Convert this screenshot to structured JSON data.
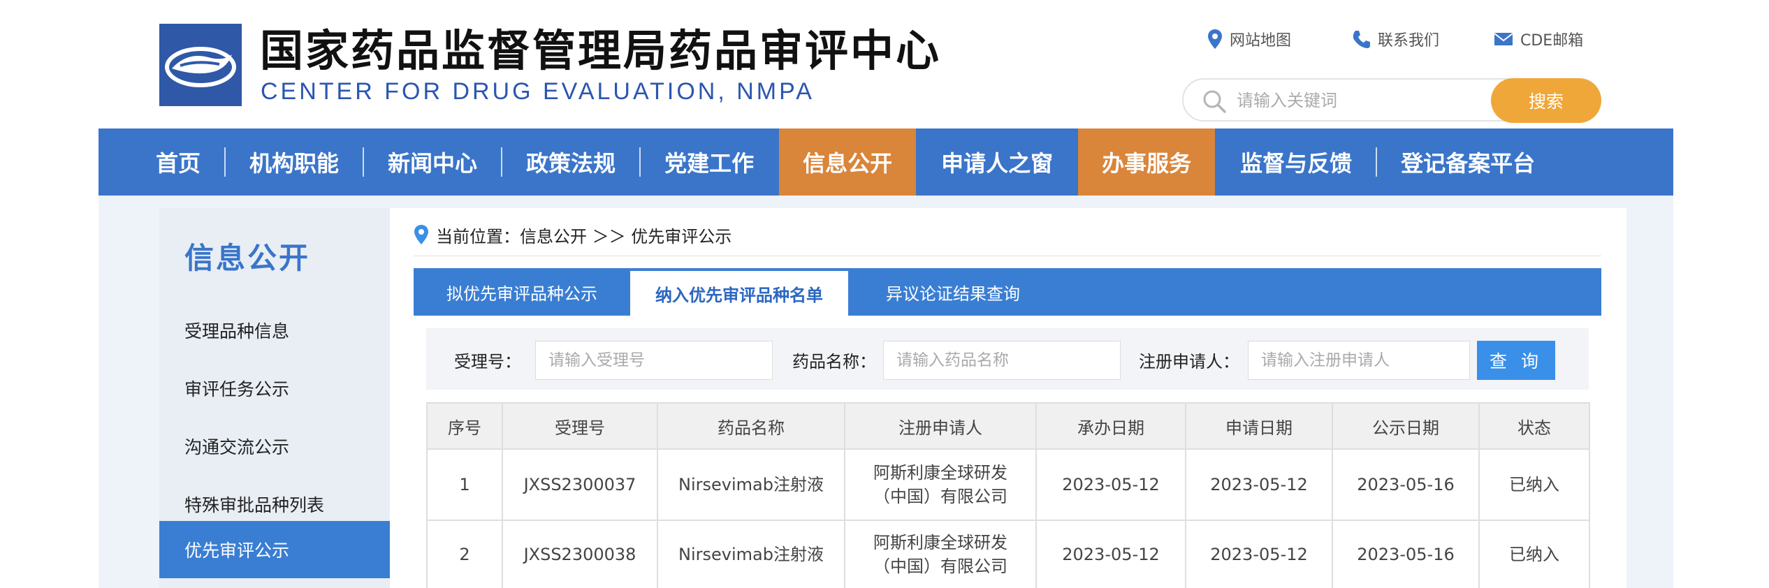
{
  "header": {
    "title": "国家药品监督管理局药品审评中心",
    "subtitle": "CENTER FOR DRUG EVALUATION, NMPA",
    "links": [
      {
        "label": "网站地图",
        "icon": "location-pin-icon"
      },
      {
        "label": "联系我们",
        "icon": "phone-icon"
      },
      {
        "label": "CDE邮箱",
        "icon": "mail-icon"
      }
    ],
    "search": {
      "placeholder": "请输入关键词",
      "value": "",
      "button": "搜索"
    }
  },
  "nav": {
    "items": [
      {
        "label": "首页"
      },
      {
        "label": "机构职能"
      },
      {
        "label": "新闻中心"
      },
      {
        "label": "政策法规"
      },
      {
        "label": "党建工作"
      },
      {
        "label": "信息公开",
        "active": true
      },
      {
        "label": "申请人之窗"
      },
      {
        "label": "办事服务",
        "active": true
      },
      {
        "label": "监督与反馈"
      },
      {
        "label": "登记备案平台"
      }
    ]
  },
  "sidebar": {
    "title": "信息公开",
    "items": [
      {
        "label": "受理品种信息"
      },
      {
        "label": "审评任务公示"
      },
      {
        "label": "沟通交流公示"
      },
      {
        "label": "特殊审批品种列表"
      },
      {
        "label": "优先审评公示",
        "active": true
      }
    ]
  },
  "breadcrumb": {
    "prefix": "当前位置：",
    "path": "信息公开 ＞＞ 优先审评公示"
  },
  "tabs": [
    {
      "label": "拟优先审评品种公示"
    },
    {
      "label": "纳入优先审评品种名单",
      "active": true
    },
    {
      "label": "异议论证结果查询"
    }
  ],
  "filters": {
    "accept_no": {
      "label": "受理号：",
      "placeholder": "请输入受理号",
      "value": ""
    },
    "drug_name": {
      "label": "药品名称：",
      "placeholder": "请输入药品名称",
      "value": ""
    },
    "applicant": {
      "label": "注册申请人：",
      "placeholder": "请输入注册申请人",
      "value": ""
    },
    "query_button": "查 询"
  },
  "table": {
    "headers": [
      "序号",
      "受理号",
      "药品名称",
      "注册申请人",
      "承办日期",
      "申请日期",
      "公示日期",
      "状态"
    ],
    "rows": [
      [
        "1",
        "JXSS2300037",
        "Nirsevimab注射液",
        "阿斯利康全球研发（中国）有限公司",
        "2023-05-12",
        "2023-05-12",
        "2023-05-16",
        "已纳入"
      ],
      [
        "2",
        "JXSS2300038",
        "Nirsevimab注射液",
        "阿斯利康全球研发（中国）有限公司",
        "2023-05-12",
        "2023-05-12",
        "2023-05-16",
        "已纳入"
      ]
    ]
  },
  "colors": {
    "nav_blue": "#3a75c9",
    "accent_orange": "#d9853a",
    "search_orange": "#f0a739",
    "tab_blue": "#3a7ed3",
    "query_blue": "#3a8fe8"
  }
}
